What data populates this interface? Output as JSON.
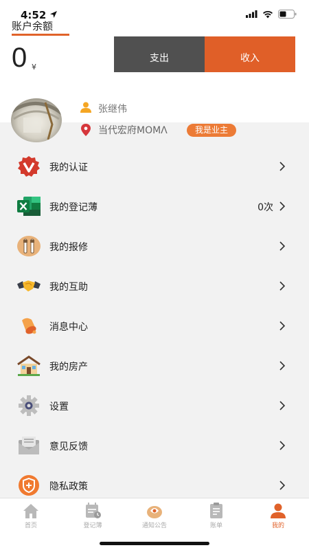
{
  "status": {
    "time": "4:52"
  },
  "account": {
    "label": "账户余额",
    "balance": "0",
    "unit": "¥"
  },
  "actions": {
    "expense_label": "支出",
    "income_label": "收入"
  },
  "profile": {
    "name": "张继伟",
    "estate": "当代宏府MOMΛ",
    "badge": "我是业主"
  },
  "menu": [
    {
      "label": "我的认证",
      "value": ""
    },
    {
      "label": "我的登记薄",
      "value": "0次"
    },
    {
      "label": "我的报修",
      "value": ""
    },
    {
      "label": "我的互助",
      "value": ""
    },
    {
      "label": "消息中心",
      "value": ""
    },
    {
      "label": "我的房产",
      "value": ""
    },
    {
      "label": "设置",
      "value": ""
    },
    {
      "label": "意见反馈",
      "value": ""
    },
    {
      "label": "隐私政策",
      "value": ""
    }
  ],
  "tabs": [
    {
      "label": "首页",
      "active": false
    },
    {
      "label": "登记薄",
      "active": false
    },
    {
      "label": "通知公告",
      "active": false
    },
    {
      "label": "账单",
      "active": false
    },
    {
      "label": "我的",
      "active": true
    }
  ],
  "colors": {
    "accent": "#e05f28",
    "dark_button": "#505050",
    "badge": "#ec7b36",
    "background_gray": "#f2f2f2"
  }
}
